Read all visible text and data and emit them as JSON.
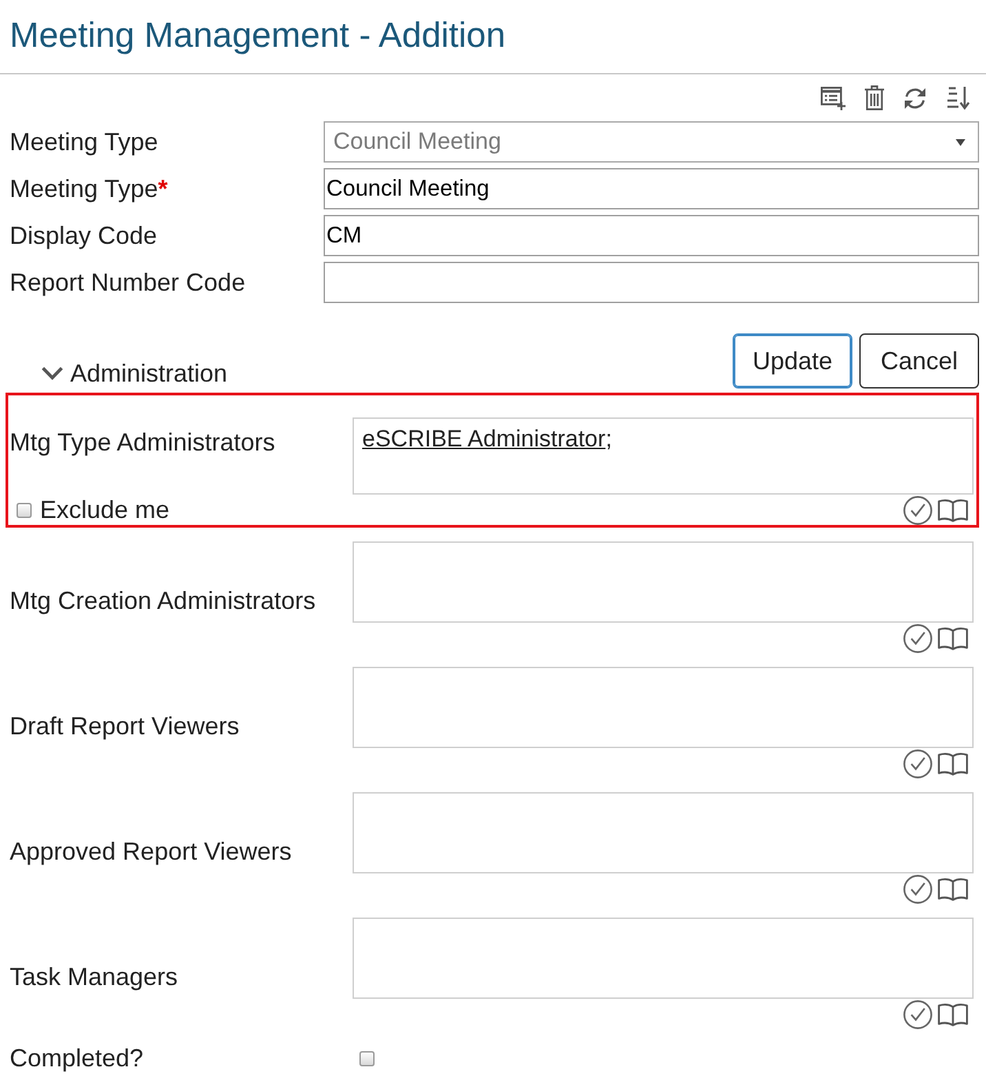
{
  "page": {
    "title": "Meeting Management - Addition"
  },
  "fields": [
    {
      "kind": "select",
      "label": "Meeting Type",
      "value": "Council Meeting",
      "disabled": true
    },
    {
      "kind": "text",
      "label": "Meeting Type",
      "required_mark": "*",
      "value": "Council Meeting",
      "disabled": false
    },
    {
      "kind": "text",
      "label": "Display Code",
      "value": "CM",
      "disabled": false
    },
    {
      "kind": "text",
      "label": "Report Number Code",
      "disabled": false
    }
  ],
  "actions": [
    {
      "label": "Update",
      "focused": true
    },
    {
      "label": "Cancel",
      "focused": false
    }
  ],
  "section": {
    "title": "Administration",
    "expanded": true
  },
  "admin_fields": [
    {
      "label": "Mtg Type Administrators",
      "highlighted": true,
      "entries": [
        {
          "name": "eSCRIBE Administrator",
          "separator": ";"
        }
      ],
      "exclude_option": {
        "label": "Exclude me",
        "checked": false
      }
    },
    {
      "label": "Mtg Creation Administrators",
      "highlighted": false
    },
    {
      "label": "Draft Report Viewers",
      "highlighted": false
    },
    {
      "label": "Approved Report Viewers",
      "highlighted": false
    },
    {
      "label": "Task Managers",
      "highlighted": false
    }
  ],
  "completed": {
    "label": "Completed?",
    "checked": false
  }
}
